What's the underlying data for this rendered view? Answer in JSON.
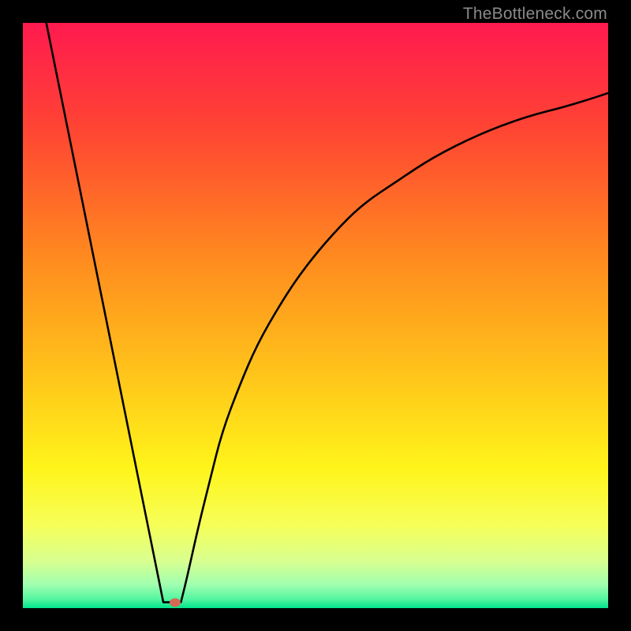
{
  "watermark": "TheBottleneck.com",
  "colors": {
    "bg": "#000000",
    "watermark": "#8a8a8a",
    "curve": "#000000",
    "marker": "#d36a54",
    "gradient_stops": [
      {
        "offset": 0.0,
        "color": "#ff1a4f"
      },
      {
        "offset": 0.18,
        "color": "#ff4433"
      },
      {
        "offset": 0.4,
        "color": "#ff8a1f"
      },
      {
        "offset": 0.6,
        "color": "#ffc41a"
      },
      {
        "offset": 0.76,
        "color": "#fff41a"
      },
      {
        "offset": 0.86,
        "color": "#f6ff5a"
      },
      {
        "offset": 0.92,
        "color": "#d8ff90"
      },
      {
        "offset": 0.96,
        "color": "#a0ffb0"
      },
      {
        "offset": 0.985,
        "color": "#52f5a0"
      },
      {
        "offset": 1.0,
        "color": "#00e58b"
      }
    ]
  },
  "chart_data": {
    "type": "line",
    "title": "",
    "xlabel": "",
    "ylabel": "",
    "xlim": [
      0,
      100
    ],
    "ylim": [
      0,
      100
    ],
    "grid": false,
    "legend": false,
    "marker": {
      "x": 26,
      "y": 1
    },
    "series": [
      {
        "name": "left-line",
        "x": [
          4,
          24
        ],
        "y": [
          100,
          1
        ]
      },
      {
        "name": "right-curve",
        "x": [
          27,
          28,
          30,
          32,
          34,
          37,
          40,
          44,
          48,
          53,
          58,
          64,
          70,
          78,
          86,
          94,
          100
        ],
        "y": [
          1,
          5,
          14,
          22,
          30,
          38,
          45,
          52,
          58,
          64,
          69,
          73,
          77,
          81,
          84,
          86,
          88
        ]
      },
      {
        "name": "valley-floor",
        "x": [
          24,
          27
        ],
        "y": [
          1,
          1
        ]
      }
    ]
  }
}
